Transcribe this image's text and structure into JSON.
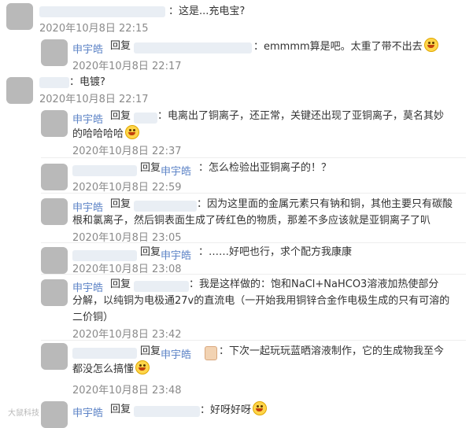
{
  "comments": [
    {
      "type": "top",
      "text": "：这是...充电宝?",
      "time": "2020年10月8日 22:15"
    },
    {
      "type": "reply",
      "author": "申宇皓",
      "reply_word": "回复",
      "text": "：emmmm算是吧。太重了带不出去",
      "time": "2020年10月8日 22:17",
      "emoji": "grin"
    },
    {
      "type": "top",
      "text": "：电镀?",
      "time": "2020年10月8日 22:17"
    },
    {
      "type": "reply",
      "author": "申宇皓",
      "reply_word": "回复",
      "text1": "：电离出了铜离子，还正常，关键还出现了亚铜离子，莫名其妙",
      "text2": "的哈哈哈哈",
      "time": "2020年10月8日 22:37",
      "emoji": "laugh"
    },
    {
      "type": "reply_to",
      "author": "申宇皓",
      "reply_word": "回复",
      "text": "：怎么检验出亚铜离子的！？",
      "time": "2020年10月8日 22:59"
    },
    {
      "type": "reply",
      "author": "申宇皓",
      "reply_word": "回复",
      "text1": "：因为这里面的金属元素只有钠和铜，其他主要只有碳酸",
      "text2": "根和氯离子，然后铜表面生成了砖红色的物质，那差不多应该就是亚铜离子了叭",
      "time": "2020年10月8日 23:05"
    },
    {
      "type": "reply_to",
      "author": "申宇皓",
      "reply_word": "回复",
      "text": "：……好吧也行，求个配方我康康",
      "time": "2020年10月8日 23:08"
    },
    {
      "type": "reply",
      "author": "申宇皓",
      "reply_word": "回复",
      "text1": "：我是这样做的：饱和NaCl+NaHCO3溶液加热使部分",
      "text2": "分解，以纯铜为电极通27v的直流电（一开始我用铜锌合金作电极生成的只有可溶的",
      "text3": "二价铜）",
      "time": "2020年10月8日 23:42"
    },
    {
      "type": "reply_to",
      "author": "申宇皓",
      "reply_word": "回复",
      "text1": "：下次一起玩玩蓝晒溶液制作，它的生成物我至今",
      "text2": "都没怎么搞懂",
      "time": "2020年10月8日 23:48",
      "emoji": "laugh"
    },
    {
      "type": "reply",
      "author": "申宇皓",
      "reply_word": "回复",
      "text": "：好呀好呀",
      "emoji": "grin"
    }
  ],
  "watermark": "大鼠科技",
  "icons": {
    "emoji": "emoji-icon",
    "thumb": "thumbs-up-icon"
  }
}
